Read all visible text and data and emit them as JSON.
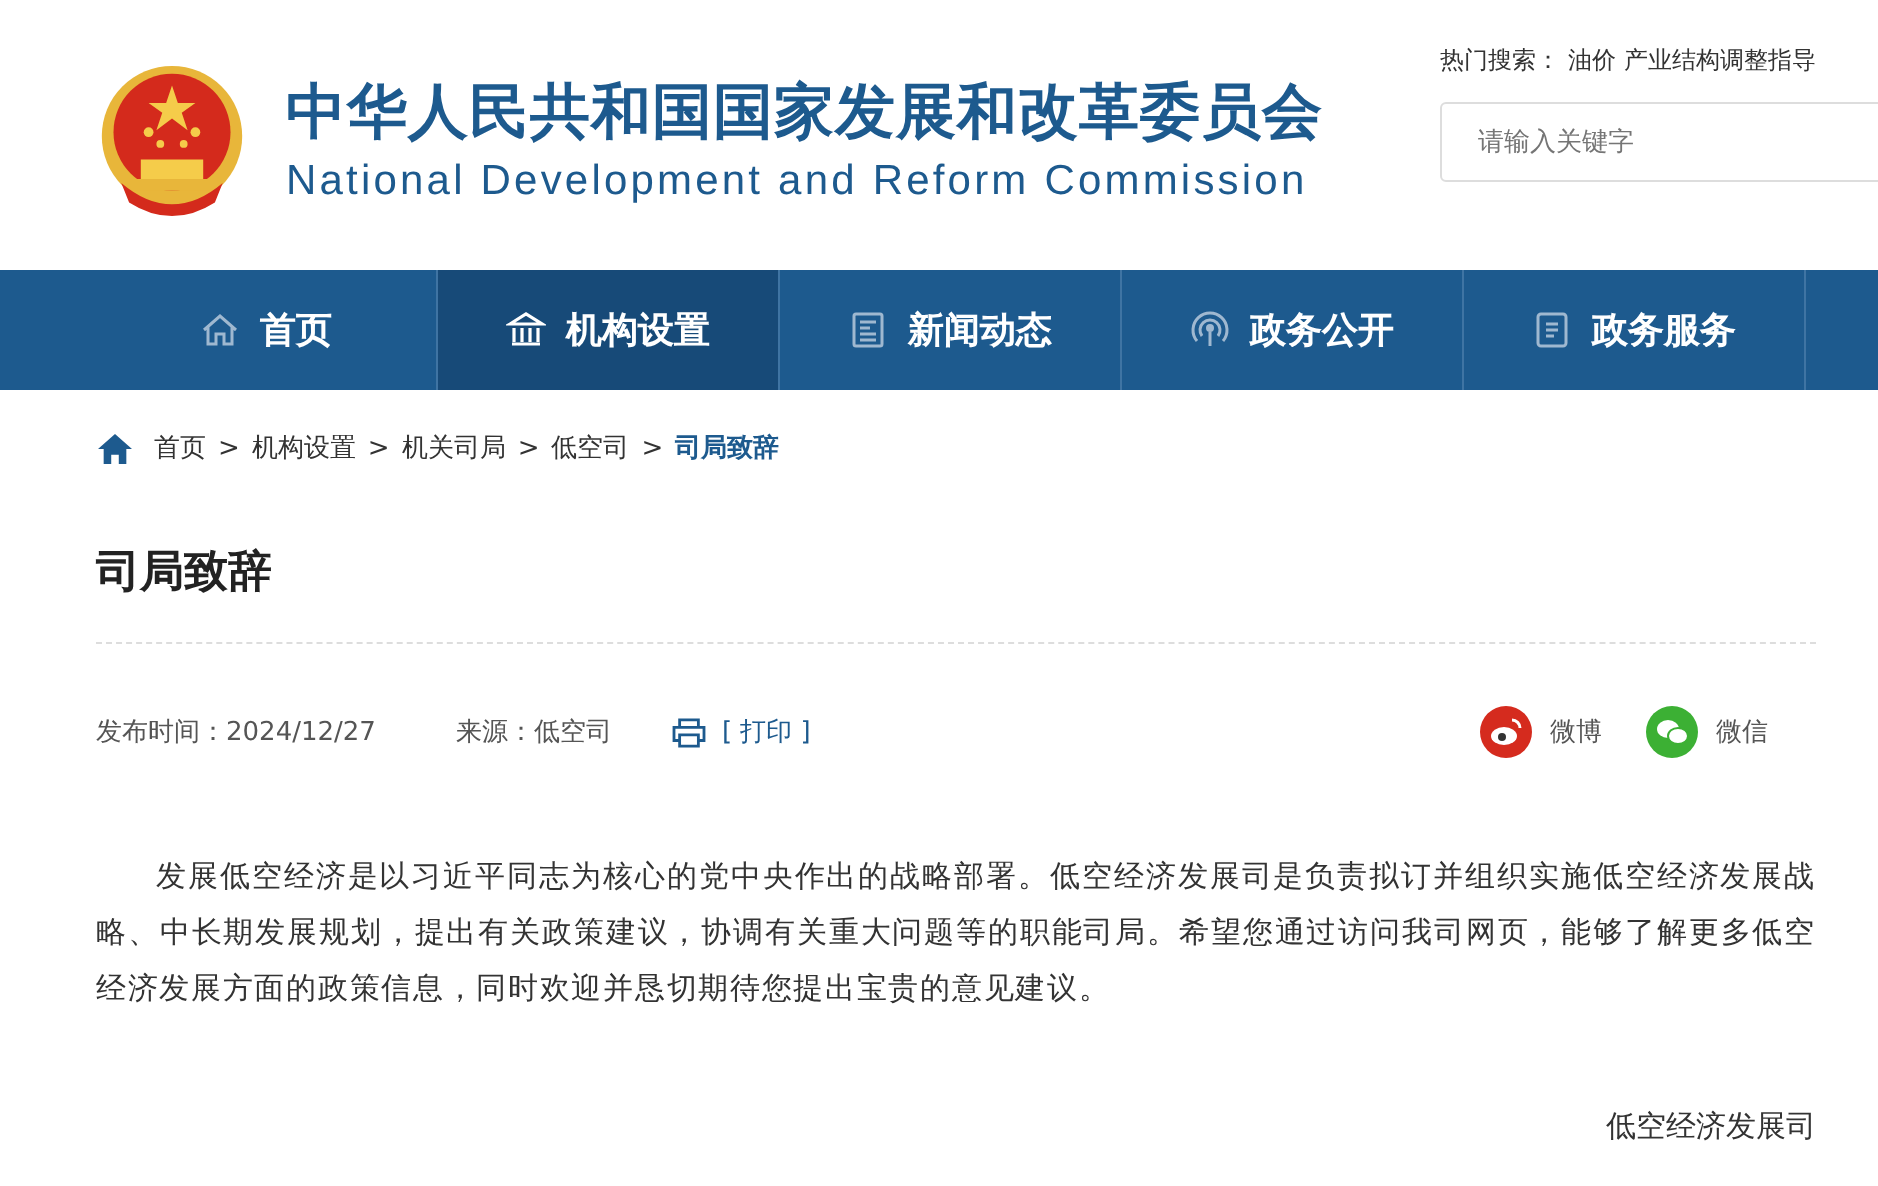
{
  "header": {
    "title_cn": "中华人民共和国国家发展和改革委员会",
    "title_en": "National Development and Reform Commission",
    "hot_search_label": "热门搜索：",
    "hot_search_items": [
      "油价",
      "产业结构调整指导"
    ],
    "search": {
      "placeholder": "请输入关键字"
    }
  },
  "nav": [
    {
      "label": "首页",
      "selected": false
    },
    {
      "label": "机构设置",
      "selected": true
    },
    {
      "label": "新闻动态",
      "selected": false
    },
    {
      "label": "政务公开",
      "selected": false
    },
    {
      "label": "政务服务",
      "selected": false
    }
  ],
  "breadcrumb": [
    {
      "kind": "link",
      "text": "首页"
    },
    {
      "kind": "sep",
      "text": ">"
    },
    {
      "kind": "link",
      "text": "机构设置"
    },
    {
      "kind": "sep",
      "text": ">"
    },
    {
      "kind": "link",
      "text": "机关司局"
    },
    {
      "kind": "sep",
      "text": ">"
    },
    {
      "kind": "link",
      "text": "低空司"
    },
    {
      "kind": "sep",
      "text": ">"
    },
    {
      "kind": "current",
      "text": "司局致辞"
    }
  ],
  "article": {
    "title": "司局致辞",
    "date": "发布时间：2024/12/27",
    "source": "来源：低空司",
    "print": "[ 打印 ]",
    "share": [
      {
        "label": "微博",
        "kind": "weibo",
        "color": "#d52b1e"
      },
      {
        "label": "微信",
        "kind": "wechat",
        "color": "#3cb034"
      }
    ],
    "body": "发展低空经济是以习近平同志为核心的党中央作出的战略部署。低空经济发展司是负责拟订并组织实施低空经济发展战略、中长期发展规划，提出有关政策建议，协调有关重大问题等的职能司局。希望您通过访问我司网页，能够了解更多低空经济发展方面的政策信息，同时欢迎并恳切期待您提出宝贵的意见建议。",
    "signature": "低空经济发展司"
  }
}
